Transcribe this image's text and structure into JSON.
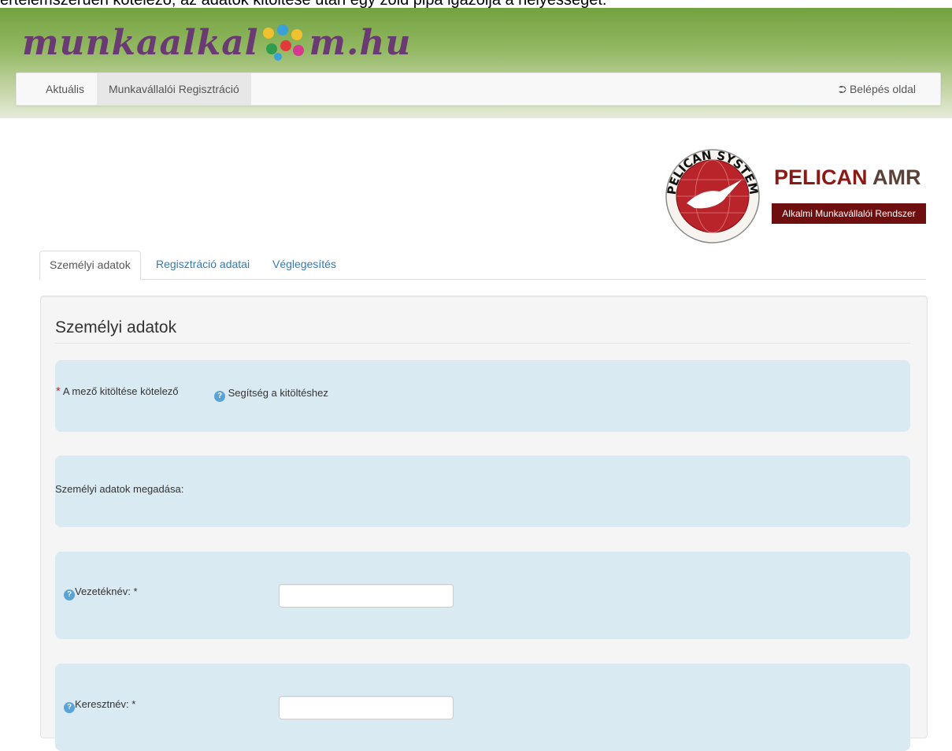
{
  "caption": "értelemszerűen kötelező, az adatok kitöltése után egy zöld pipa igazolja a helyességet.",
  "brand": {
    "logo_left": "munkaalkal",
    "logo_right": "m.hu"
  },
  "navbar": {
    "items": [
      {
        "label": "Aktuális"
      },
      {
        "label": "Munkavállalói Regisztráció"
      }
    ],
    "login_label": "Belépés oldal"
  },
  "pelican": {
    "seal_text": "PELICAN SYSTEM",
    "title_main": "PELICAN",
    "title_accent": "AMR",
    "subtitle": "Alkalmi Munkavállalói Rendszer",
    "colors": {
      "title": "#8b1a14",
      "subtitle_bg": "#6e0e0e"
    }
  },
  "tabs": [
    {
      "label": "Személyi adatok"
    },
    {
      "label": "Regisztráció adatai"
    },
    {
      "label": "Véglegesítés"
    }
  ],
  "form": {
    "section_title": "Személyi adatok",
    "required_note": "A mező kitöltése kötelező",
    "help_note": "Segítség a kitöltéshez",
    "intro_text": "Személyi adatok megadása:",
    "fields": [
      {
        "label": "Vezetéknév: *",
        "value": ""
      },
      {
        "label": "Keresztnév: *",
        "value": ""
      }
    ]
  },
  "colors": {
    "link": "#337ab7",
    "info_box": "#d9eaf2",
    "required": "#d9231f"
  }
}
